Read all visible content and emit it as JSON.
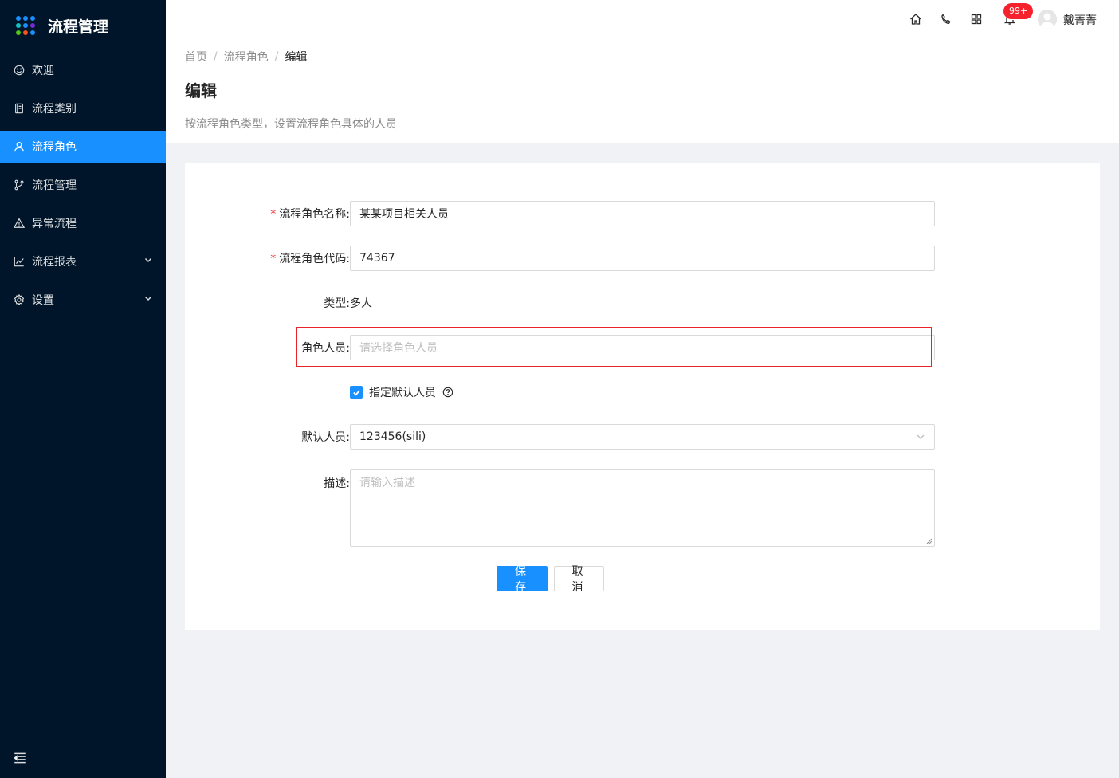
{
  "app": {
    "title": "流程管理"
  },
  "colors": {
    "sidebar_bg": "#001529",
    "primary": "#1890ff",
    "highlight": "#e8242a",
    "badge": "#f5222d"
  },
  "sidebar": {
    "items": [
      {
        "label": "欢迎",
        "icon": "smile-icon",
        "active": false
      },
      {
        "label": "流程类别",
        "icon": "book-icon",
        "active": false
      },
      {
        "label": "流程角色",
        "icon": "user-icon",
        "active": true
      },
      {
        "label": "流程管理",
        "icon": "branch-icon",
        "active": false
      },
      {
        "label": "异常流程",
        "icon": "warning-icon",
        "active": false
      },
      {
        "label": "流程报表",
        "icon": "line-chart-icon",
        "active": false,
        "expandable": true
      },
      {
        "label": "设置",
        "icon": "gear-icon",
        "active": false,
        "expandable": true
      }
    ]
  },
  "header": {
    "icons": [
      "home-icon",
      "phone-icon",
      "apps-icon",
      "bell-icon"
    ],
    "notification_badge": "99+",
    "username": "戴菁菁"
  },
  "breadcrumb": {
    "items": [
      "首页",
      "流程角色",
      "编辑"
    ]
  },
  "page": {
    "title": "编辑",
    "description": "按流程角色类型，设置流程角色具体的人员"
  },
  "form": {
    "role_name": {
      "label": "流程角色名称:",
      "value": "某某项目相关人员",
      "required": true
    },
    "role_code": {
      "label": "流程角色代码:",
      "value": "74367",
      "required": true
    },
    "type": {
      "label": "类型:",
      "value": "多人"
    },
    "role_members": {
      "label": "角色人员:",
      "placeholder": "请选择角色人员"
    },
    "default_checkbox": {
      "label": "指定默认人员",
      "checked": true
    },
    "default_member": {
      "label": "默认人员:",
      "value": "123456(sili)"
    },
    "description": {
      "label": "描述:",
      "placeholder": "请输入描述"
    },
    "save_label": "保存",
    "cancel_label": "取消"
  }
}
